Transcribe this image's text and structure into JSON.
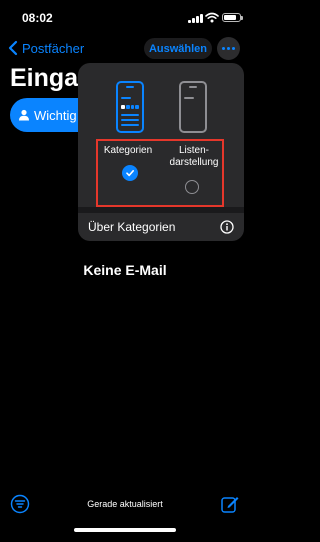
{
  "status_bar": {
    "time": "08:02"
  },
  "nav": {
    "back_label": "Postfächer",
    "select_label": "Auswählen"
  },
  "mailbox": {
    "title": "Eingangs",
    "category_chip": "Wichtig"
  },
  "view_menu": {
    "option_categories": "Kategorien",
    "option_list_line1": "Listen-",
    "option_list_line2": "darstellung",
    "selected_option": "Kategorien",
    "about_label": "Über Kategorien"
  },
  "empty_state": "Keine E-Mail",
  "toolbar": {
    "status_text": "Gerade aktualisiert"
  },
  "colors": {
    "accent": "#0a84ff",
    "highlight": "#e5372b",
    "background": "#000000",
    "popup": "#2a2a2c"
  },
  "icons": [
    "chevron-left-icon",
    "more-icon",
    "person-icon",
    "checkmark-icon",
    "radio-empty-icon",
    "info-icon",
    "filter-icon",
    "compose-icon",
    "wifi-icon",
    "battery-icon",
    "signal-icon"
  ]
}
